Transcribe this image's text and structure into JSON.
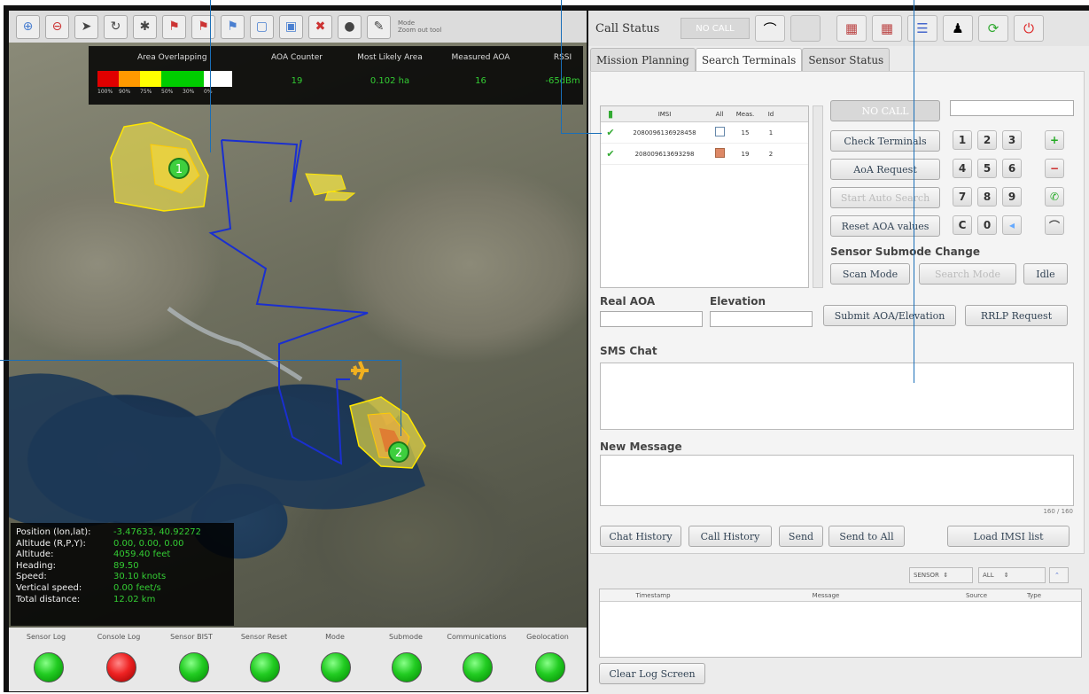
{
  "toolbar": {
    "mode_label": "Mode",
    "mode_value": "Zoom out tool"
  },
  "overlay": {
    "legend_title": "Area Overlapping",
    "legend_colors": [
      "#e00000",
      "#ff9900",
      "#ffff00",
      "#00cc00",
      "#ffffff"
    ],
    "legend_ticks": [
      "100%",
      "90%",
      "75%",
      "50%",
      "30%",
      "0%"
    ],
    "aoa_counter_label": "AOA Counter",
    "aoa_counter_value": "19",
    "most_likely_label": "Most Likely Area",
    "most_likely_value": "0.102 ha",
    "measured_aoa_label": "Measured AOA",
    "measured_aoa_value": "16",
    "rssi_label": "RSSI",
    "rssi_value": "-65dBm"
  },
  "map": {
    "markers": [
      "1",
      "2"
    ]
  },
  "info": {
    "rows": [
      {
        "k": "Position (lon,lat):",
        "v": "-3.47633, 40.92272"
      },
      {
        "k": "Altitude (R,P,Y):",
        "v": "0.00, 0.00, 0.00"
      },
      {
        "k": "Altitude:",
        "v": "4059.40 feet"
      },
      {
        "k": "Heading:",
        "v": "89.50"
      },
      {
        "k": "Speed:",
        "v": "30.10 knots"
      },
      {
        "k": "Vertical speed:",
        "v": "0.00 feet/s"
      },
      {
        "k": "Total distance:",
        "v": "12.02 km"
      }
    ]
  },
  "status": [
    {
      "label": "Sensor Log",
      "state": "green"
    },
    {
      "label": "Console Log",
      "state": "red"
    },
    {
      "label": "Sensor BIST",
      "state": "green"
    },
    {
      "label": "Sensor Reset",
      "state": "green"
    },
    {
      "label": "Mode",
      "state": "green"
    },
    {
      "label": "Submode",
      "state": "green"
    },
    {
      "label": "Communications",
      "state": "green"
    },
    {
      "label": "Geolocation",
      "state": "green"
    }
  ],
  "call": {
    "label": "Call Status",
    "status": "NO CALL"
  },
  "tabs": [
    "Mission Planning",
    "Search Terminals",
    "Sensor Status"
  ],
  "terminals": {
    "headers": [
      "IMSI",
      "All",
      "Meas.",
      "Id"
    ],
    "rows": [
      {
        "imsi": "2080096136928458",
        "all": false,
        "meas": "15",
        "id": "1"
      },
      {
        "imsi": "208009613693298",
        "all": true,
        "meas": "19",
        "id": "2"
      }
    ]
  },
  "buttons": {
    "no_call": "NO CALL",
    "check_terminals": "Check Terminals",
    "aoa_request": "AoA Request",
    "start_auto_search": "Start Auto Search",
    "reset_aoa": "Reset AOA values",
    "scan_mode": "Scan Mode",
    "search_mode": "Search Mode",
    "idle": "Idle",
    "submit_aoa": "Submit AOA/Elevation",
    "rrlp_request": "RRLP Request",
    "chat_history": "Chat History",
    "call_history": "Call History",
    "send": "Send",
    "send_all": "Send to All",
    "load_imsi": "Load IMSI list",
    "clear_log": "Clear Log Screen"
  },
  "keypad": [
    "1",
    "2",
    "3",
    "4",
    "5",
    "6",
    "7",
    "8",
    "9",
    "C",
    "0"
  ],
  "sensor_submode_title": "Sensor Submode Change",
  "real_aoa_label": "Real AOA",
  "elevation_label": "Elevation",
  "sms_chat_label": "SMS Chat",
  "new_message_label": "New Message",
  "char_counter": "160 / 160",
  "log": {
    "source_select": "SENSOR",
    "filter_select": "ALL",
    "headers": [
      "Timestamp",
      "Message",
      "Source",
      "Type"
    ]
  }
}
